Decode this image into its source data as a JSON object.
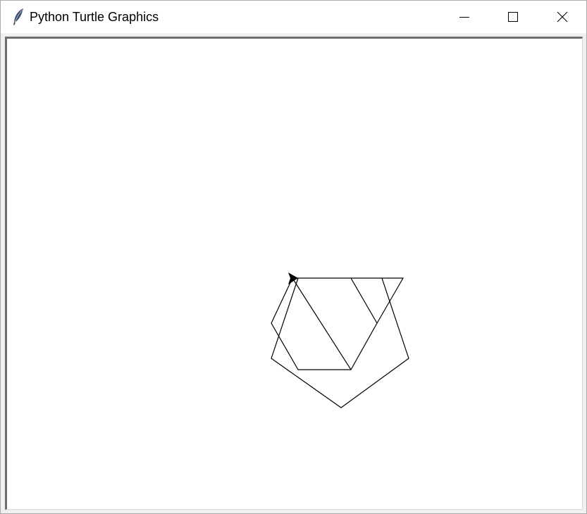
{
  "window": {
    "title": "Python Turtle Graphics",
    "icon": "feather-icon",
    "controls": {
      "minimize": "minimize-icon",
      "maximize": "maximize-icon",
      "close": "close-icon"
    }
  },
  "canvas": {
    "background": "#ffffff",
    "pen_color": "#000000",
    "turtle_shape": "arrow-cursor-icon"
  }
}
